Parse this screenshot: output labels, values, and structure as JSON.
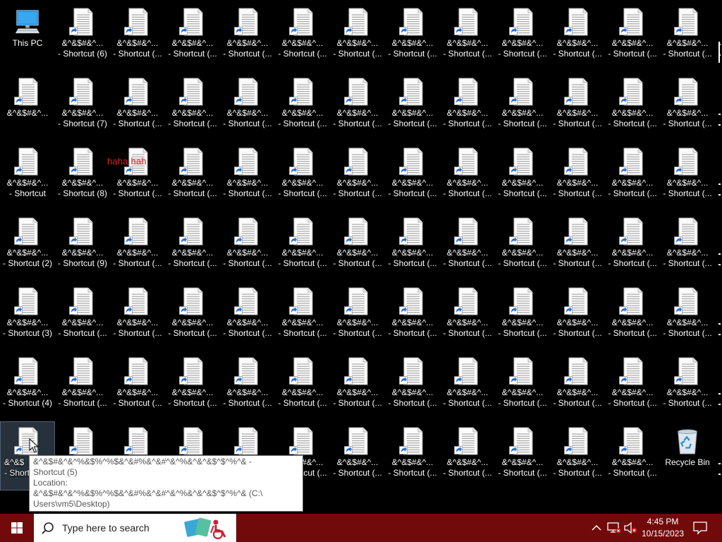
{
  "desktop": {
    "this_pc": {
      "label": "This PC",
      "icon": "this-pc-icon"
    },
    "recycle_bin": {
      "label": "Recycle Bin",
      "icon": "recycle-bin-icon"
    },
    "shortcut_icon": "shortcut-file-icon",
    "file_name_line": "&^&$#&^...",
    "shortcut_line_truncated": "- Shortcut (...",
    "numbered": {
      "c1r0": "- Shortcut (6)",
      "c1r1": "- Shortcut (7)",
      "c1r2": "- Shortcut (8)",
      "c1r3": "- Shortcut (9)",
      "c0r2": "- Shortcut",
      "c0r3": "- Shortcut (2)",
      "c0r4": "- Shortcut (3)",
      "c0r5": "- Shortcut (4)"
    },
    "selected_label_partial": [
      "&^&$",
      "- Short"
    ],
    "overlay_text": "haha hah"
  },
  "tooltip": {
    "lines": [
      "&^&$#&^&^%&$%^%$&^&#%&^&#^&^%&^&^&$^$^%^& -",
      "Shortcut (5)",
      "Location:",
      "&^&$#&^&^%&$%^%$&^&#%&^&#^&^%&^&^&$^$^%^& (C:\\",
      "Users\\vm5\\Desktop)"
    ]
  },
  "taskbar": {
    "color": "#710b0b",
    "start_icon": "windows-start-icon",
    "search_placeholder": "Type here to search",
    "search_icon": "search-icon",
    "clock": {
      "time": "4:45 PM",
      "date": "10/15/2023"
    }
  }
}
